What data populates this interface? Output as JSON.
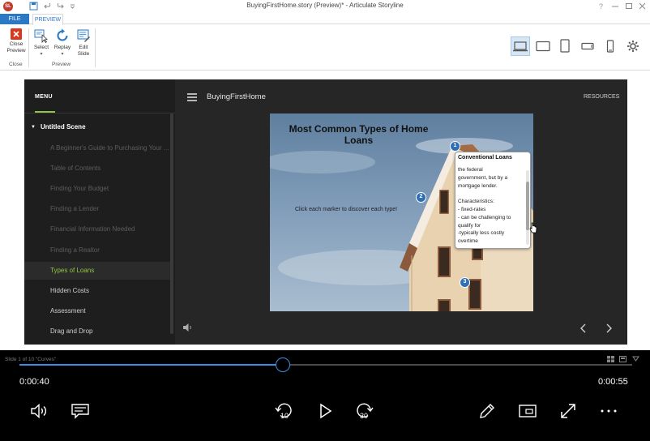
{
  "window": {
    "title": "BuyingFirstHome.story (Preview)* -  Articulate Storyline",
    "app_badge": "SL"
  },
  "ribbon": {
    "tabs": {
      "file": "FILE",
      "preview": "PREVIEW"
    },
    "close_preview_label_1": "Close",
    "close_preview_label_2": "Preview",
    "select_label": "Select",
    "replay_label": "Replay",
    "edit_slide_label_1": "Edit",
    "edit_slide_label_2": "Slide",
    "group_close": "Close",
    "group_preview": "Preview",
    "devices": [
      "laptop-icon",
      "tablet-landscape-icon",
      "tablet-portrait-icon",
      "phone-landscape-icon",
      "phone-portrait-icon"
    ],
    "settings_icon": "gear-icon"
  },
  "player": {
    "menu_label": "MENU",
    "course_title": "BuyingFirstHome",
    "resources_label": "RESOURCES",
    "scene": "Untitled Scene",
    "slides": [
      "A Beginner's Guide to Purchasing Your ...",
      "Table of Contents",
      "Finding Your Budget",
      "Finding a Lender",
      "Financial Information Needed",
      "Finding a Realtor",
      "Types of Loans",
      "Hidden Costs",
      "Assessment",
      "Drag and Drop"
    ],
    "accent_color": "#8fc640"
  },
  "slide": {
    "title": "Most Common Types of Home Loans",
    "instruction": "Click each marker to discover each type!",
    "markers": [
      "1",
      "2",
      "3"
    ],
    "callout": {
      "heading": "Conventional Loans",
      "body": "the federal\ngovernment, but by a\nmortgage lender.\n\nCharacteristics:\n- fixed-rates\n- can be challenging to\nqualify for\n-typically less costly\novertime"
    }
  },
  "media": {
    "slide_counter": "Slide 1 of 10   \"Curves\"",
    "current_time": "0:00:40",
    "total_time": "0:00:55",
    "progress": 0.43,
    "accent_color": "#3a8ee6",
    "controls": [
      "volume-icon",
      "captions-icon",
      "rewind-10-icon",
      "play-icon",
      "forward-30-icon",
      "pen-icon",
      "cast-icon",
      "fullscreen-icon",
      "more-icon"
    ],
    "rewind_label": "10",
    "forward_label": "30"
  }
}
